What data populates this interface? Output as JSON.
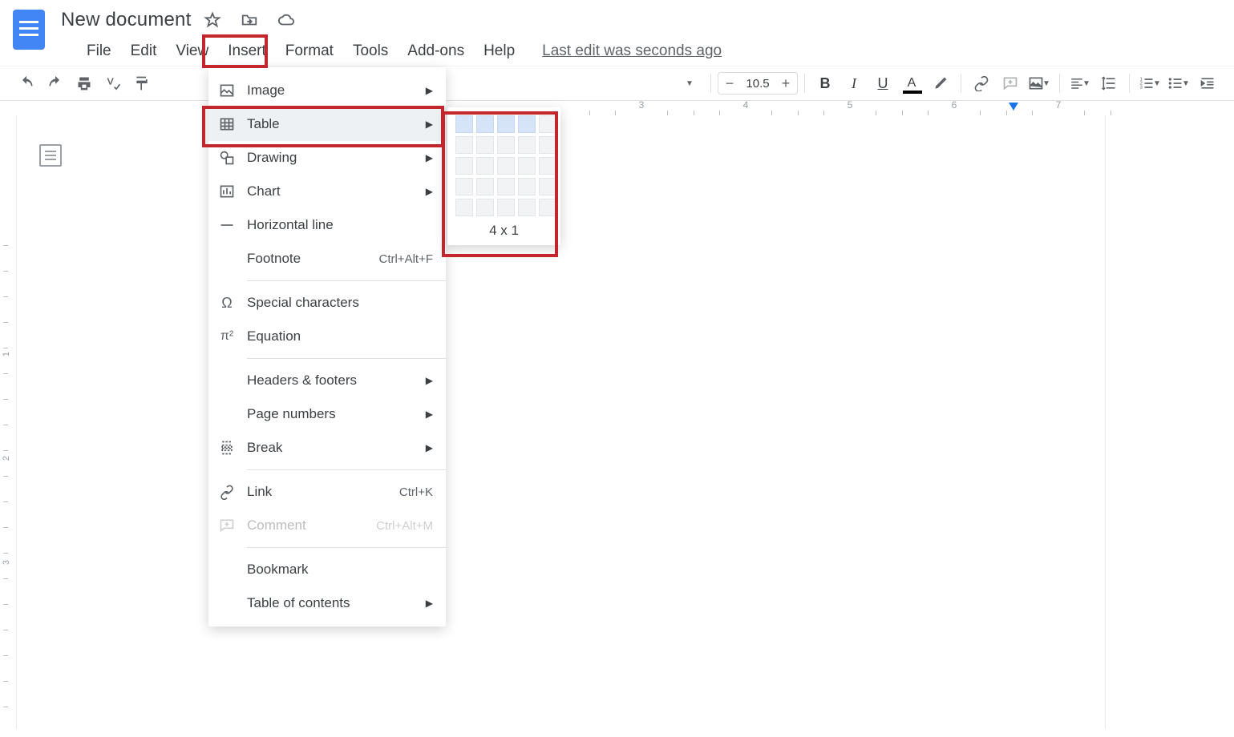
{
  "doc_title": "New document",
  "last_edit": "Last edit was seconds ago",
  "menu": {
    "file": "File",
    "edit": "Edit",
    "view": "View",
    "insert": "Insert",
    "format": "Format",
    "tools": "Tools",
    "addons": "Add-ons",
    "help": "Help"
  },
  "toolbar": {
    "font_size": "10.5",
    "minus": "−",
    "plus": "+"
  },
  "insert_menu": {
    "image": "Image",
    "table": "Table",
    "drawing": "Drawing",
    "chart": "Chart",
    "hline": "Horizontal line",
    "footnote": "Footnote",
    "footnote_sc": "Ctrl+Alt+F",
    "special": "Special characters",
    "equation": "Equation",
    "headers": "Headers & footers",
    "pagenum": "Page numbers",
    "break": "Break",
    "link": "Link",
    "link_sc": "Ctrl+K",
    "comment": "Comment",
    "comment_sc": "Ctrl+Alt+M",
    "bookmark": "Bookmark",
    "toc": "Table of contents"
  },
  "table_submenu": {
    "label": "4 x 1",
    "sel_cols": 4,
    "sel_rows": 1
  },
  "ruler_h": [
    "3",
    "4",
    "5",
    "6",
    "7"
  ],
  "ruler_v": [
    "1",
    "2",
    "3"
  ]
}
